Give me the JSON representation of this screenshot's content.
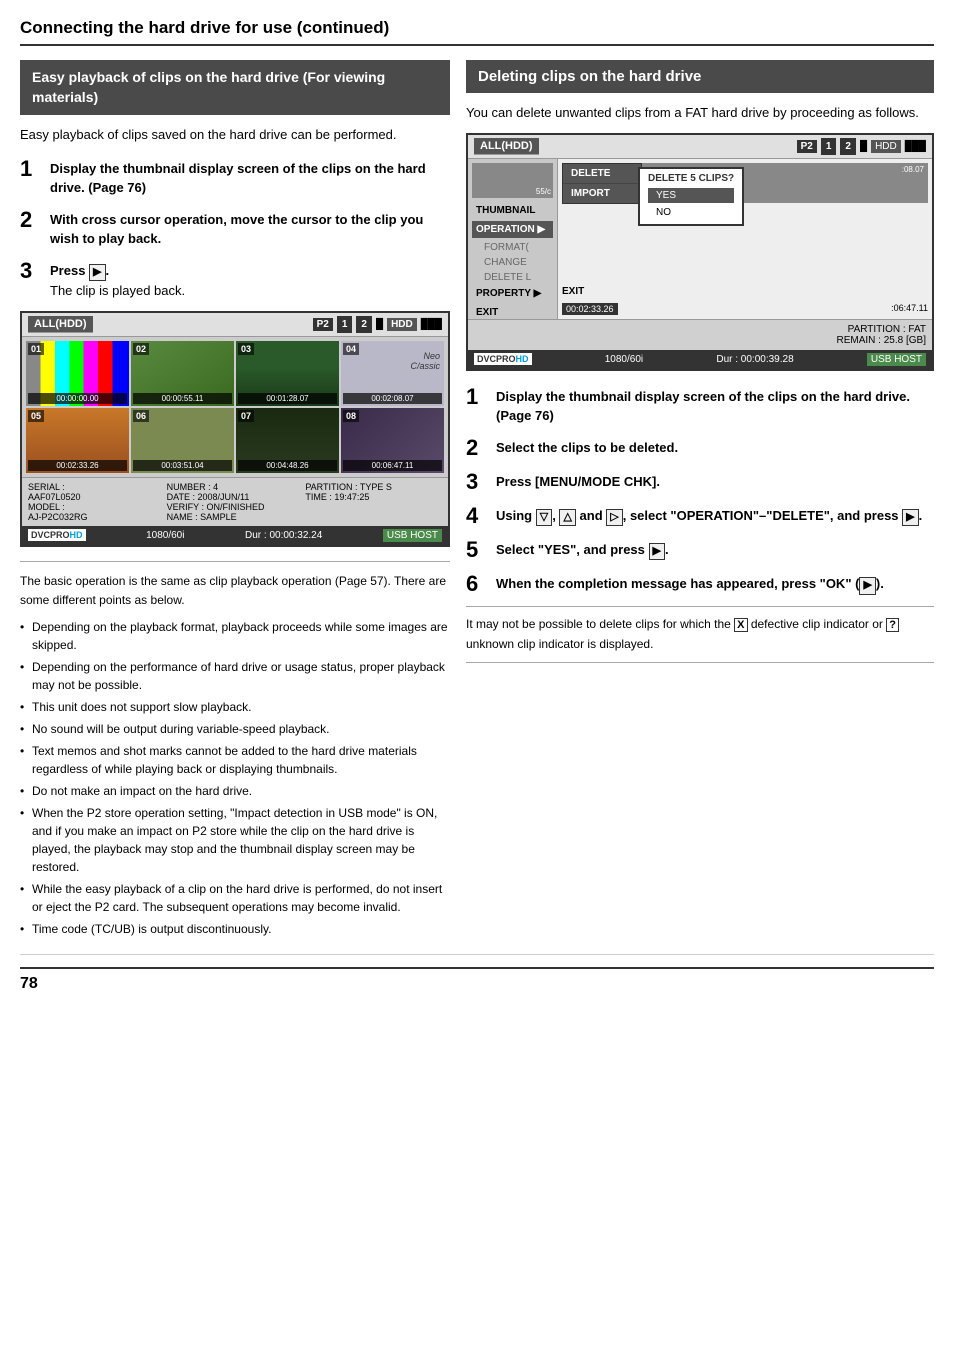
{
  "page": {
    "title": "Connecting the hard drive for use (continued)",
    "page_number": "78"
  },
  "left_section": {
    "box_title": "Easy playback of clips on the hard drive (For viewing materials)",
    "intro": "Easy playback of clips saved on the hard drive can be performed.",
    "steps": [
      {
        "num": "1",
        "text": "Display the thumbnail display screen of the clips on the hard drive. (Page 76)"
      },
      {
        "num": "2",
        "text": "With cross cursor operation, move the cursor to the clip you wish to play back."
      },
      {
        "num": "3",
        "text_pre": "Press ",
        "text_key": "▶",
        "text_post": ".\nThe clip is played back."
      }
    ],
    "thumbnail_display": {
      "all_label": "ALL(HDD)",
      "p2_label": "P2",
      "slots": [
        "1",
        "2"
      ],
      "hdd": "HDD",
      "clips": [
        {
          "num": "01",
          "timecode": "00:00:00.00",
          "style": "color-bars"
        },
        {
          "num": "02",
          "timecode": "00:00:55.11",
          "style": "t2"
        },
        {
          "num": "03",
          "timecode": "00:01:28.07",
          "style": "t3"
        },
        {
          "num": "04",
          "timecode": "00:02:08.07",
          "style": "t4",
          "label": "Neo\nC/assic"
        },
        {
          "num": "05",
          "timecode": "00:02:33.26",
          "style": "t5"
        },
        {
          "num": "06",
          "timecode": "00:03:51.04",
          "style": "t6"
        },
        {
          "num": "07",
          "timecode": "00:04:48.26",
          "style": "t7"
        },
        {
          "num": "08",
          "timecode": "00:06:47.11",
          "style": "t8"
        }
      ],
      "info_serial": "SERIAL :",
      "info_serial_val": "AAF07L0520",
      "info_model": "MODEL :",
      "info_model_val": "AJ-P2C032RG",
      "info_number": "NUMBER : 4",
      "info_date": "DATE : 2008/JUN/11",
      "info_time": "TIME : 19:47:25",
      "info_partition": "PARTITION : TYPE S",
      "info_verify": "VERIFY : ON/FINISHED",
      "info_name": "NAME : SAMPLE",
      "status_brand": "DVCPRO HD",
      "status_res": "1080/60i",
      "status_dur": "Dur : 00:00:32.24",
      "status_host": "USB HOST"
    },
    "notes_intro": "The basic operation is the same as clip playback operation (Page 57). There are some different points as below.",
    "bullets": [
      "Depending on the playback format, playback proceeds while some images are skipped.",
      "Depending on the performance of hard drive or usage status, proper playback may not be possible.",
      "This unit does not support slow playback.",
      "No sound will be output during variable-speed playback.",
      "Text memos and shot marks cannot be added to the hard drive materials regardless of while playing back or displaying thumbnails.",
      "Do not make an impact on the hard drive.",
      "When the P2 store operation setting, \"Impact detection in USB mode\" is ON, and if you make an impact on P2 store while the clip on the hard drive is played, the playback may stop and the thumbnail display screen may be restored.",
      "While the easy playback of a clip on the hard drive is performed, do not insert or eject the P2 card. The subsequent operations may become invalid.",
      "Time code (TC/UB) is output discontinuously."
    ]
  },
  "right_section": {
    "box_title": "Deleting clips on the hard drive",
    "intro": "You can delete unwanted clips from a FAT hard drive by proceeding as follows.",
    "delete_display": {
      "all_label": "ALL(HDD)",
      "p2_label": "P2",
      "slots": [
        "1",
        "2"
      ],
      "hdd": "HDD",
      "sidebar_items": [
        "THUMBNAIL",
        "OPERATION",
        "PROPERTY",
        "EXIT"
      ],
      "operation_submenu": [
        "FORMAT(",
        "CHANGE",
        "DELETE L"
      ],
      "popup_items": [
        "DELETE",
        "IMPORT"
      ],
      "confirm_title": "DELETE 5 CLIPS?",
      "confirm_yes": "YES",
      "confirm_no": "NO",
      "exit_item": "EXIT",
      "tc_start": "00:02:33.26",
      "tc_end": ":06:47.11",
      "tc_start2": ":08.07",
      "partition": "PARTITION : FAT",
      "remain": "REMAIN : 25.8 [GB]",
      "status_brand": "DVCPRO HD",
      "status_res": "1080/60i",
      "status_dur": "Dur : 00:00:39.28",
      "status_host": "USB HOST"
    },
    "steps": [
      {
        "num": "1",
        "text": "Display the thumbnail display screen of the clips on the hard drive. (Page 76)"
      },
      {
        "num": "2",
        "text": "Select the clips to be deleted."
      },
      {
        "num": "3",
        "text": "Press [MENU/MODE CHK]."
      },
      {
        "num": "4",
        "text_html": "Using ▽, △ and ▷, select \"OPERATION\"–\"DELETE\", and press ▶."
      },
      {
        "num": "5",
        "text_html": "Select \"YES\", and press ▶."
      },
      {
        "num": "6",
        "text_html": "When the completion message has appeared, press \"OK\" (▶)."
      }
    ],
    "note": "It may not be possible to delete clips for which the X defective clip indicator or ? unknown clip indicator is displayed."
  }
}
